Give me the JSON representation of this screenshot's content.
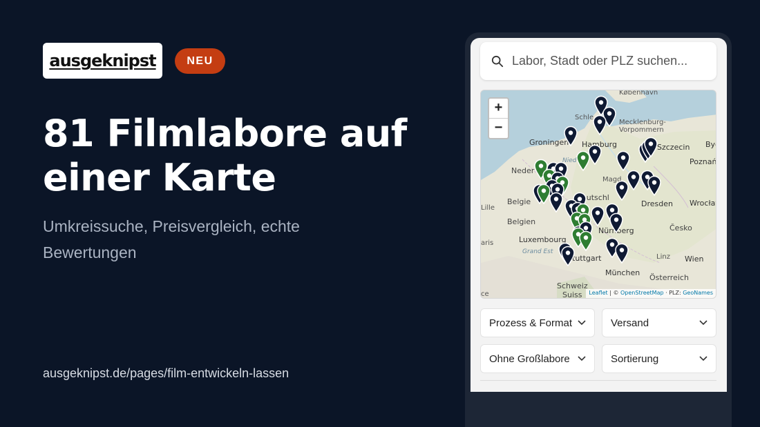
{
  "brand": {
    "logo_text": "ausgeknipst",
    "badge": "NEU"
  },
  "headline": "81 Filmlabore auf einer Karte",
  "subline": "Umkreissuche, Preisvergleich, echte Bewertungen",
  "url": "ausgeknipst.de/pages/film-entwickeln-lassen",
  "search": {
    "placeholder": "Labor, Stadt oder PLZ suchen..."
  },
  "map": {
    "zoom_in": "+",
    "zoom_out": "−",
    "labels": {
      "kobenhavn": "København",
      "schleswig": "Schle",
      "mecklenburg": "Mecklenburg-",
      "vorpommern": "Vorpommern",
      "groningen": "Groningen",
      "hamburg": "Hamburg",
      "szczecin": "Szczecin",
      "bydgoszcz": "Bydg",
      "poznan": "Poznań",
      "nied": "Nied",
      "neder": "Neder",
      "magdeburg": "Magd",
      "belgie": "Belgie",
      "lille": "Lille",
      "belgien": "Belgien",
      "deutschland": "eutschl",
      "dresden": "Dresden",
      "wroclaw": "Wrocław",
      "luxembourg": "Luxembourg",
      "nurnberg": "Nürnberg",
      "cesko": "Česko",
      "paris": "aris",
      "grandest": "Grand Est",
      "stuttgart": "tuttgart",
      "linz": "Linz",
      "wien": "Wien",
      "munchen": "München",
      "osterreich": "Österreich",
      "schweiz": "Schweiz",
      "suisse": "Suiss",
      "ce": "ce"
    },
    "attribution": {
      "leaflet": "Leaflet",
      "sep1": " | © ",
      "osm": "OpenStreetMap",
      "plz": " · PLZ: ",
      "geonames": "GeoNames"
    },
    "pin_colors": {
      "default": "#0f1a33",
      "highlight": "#2e7d32"
    }
  },
  "filters": {
    "process": "Prozess & Format",
    "shipping": "Versand",
    "large_labs": "Ohne Großlabore",
    "sort": "Sortierung"
  }
}
